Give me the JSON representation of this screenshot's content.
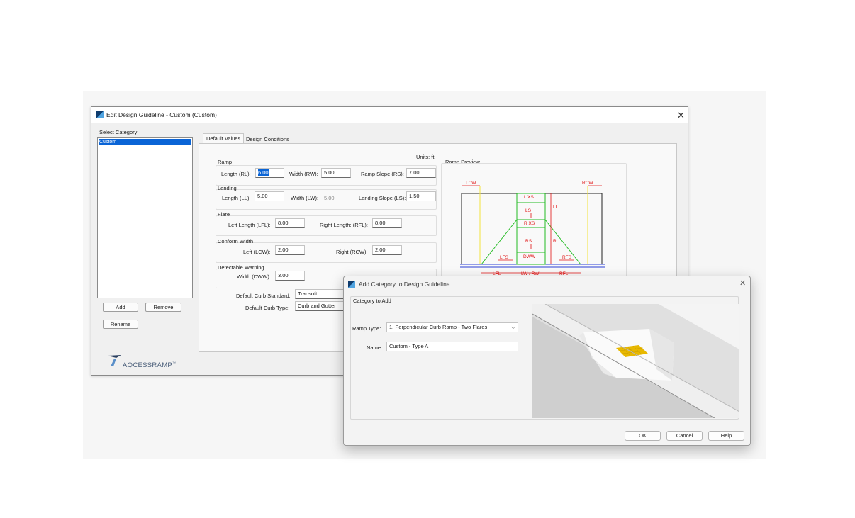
{
  "main_window": {
    "title": "Edit Design Guideline - Custom (Custom)",
    "close_glyph": "✕",
    "select_category_label": "Select Category:",
    "categories": [
      "Custom"
    ],
    "buttons": {
      "add": "Add",
      "remove": "Remove",
      "rename": "Rename"
    },
    "tabs": [
      "Default Values",
      "Design Conditions"
    ],
    "units_label": "Units: ft",
    "ramp": {
      "heading": "Ramp",
      "length_label": "Length (RL):",
      "length_value": "6.00",
      "width_label": "Width (RW):",
      "width_value": "5.00",
      "slope_label": "Ramp Slope (RS):",
      "slope_value": "7.00"
    },
    "landing": {
      "heading": "Landing",
      "length_label": "Length (LL):",
      "length_value": "5.00",
      "width_label": "Width (LW):",
      "width_value": "5.00",
      "slope_label": "Landing Slope (LS):",
      "slope_value": "1.50"
    },
    "flare": {
      "heading": "Flare",
      "left_label": "Left Length (LFL):",
      "left_value": "8.00",
      "right_label": "Right Length: (RFL):",
      "right_value": "8.00"
    },
    "conform": {
      "heading": "Conform Width",
      "left_label": "Left (LCW):",
      "left_value": "2.00",
      "right_label": "Right (RCW):",
      "right_value": "2.00"
    },
    "warning": {
      "heading": "Detectable Warning",
      "width_label": "Width (DWW):",
      "width_value": "3.00"
    },
    "curb_standard_label": "Default Curb Standard:",
    "curb_standard_value": "Transoft",
    "curb_type_label": "Default Curb Type:",
    "curb_type_value": "Curb and Gutter",
    "ramp_preview_label": "Ramp Preview",
    "diagram_labels": {
      "lcw": "LCW",
      "rcw": "RCW",
      "lxs": "L XS",
      "ls": "LS",
      "ll": "LL",
      "rxs": "R XS",
      "rs": "RS",
      "rl": "RL",
      "lfs": "LFS",
      "dww": "DWW",
      "rfs": "RFS",
      "lfl": "LFL",
      "lw_rw": "LW / RW",
      "rfl": "RFL"
    },
    "logo_text": "AQCESSRAMP",
    "logo_tm": "™"
  },
  "dialog": {
    "title": "Add Category to Design Guideline",
    "close_glyph": "✕",
    "section_label": "Category to Add",
    "ramp_type_label": "Ramp Type:",
    "ramp_type_value": "1. Perpendicular Curb Ramp - Two Flares",
    "name_label": "Name:",
    "name_value": "Custom - Type A",
    "buttons": {
      "ok": "OK",
      "cancel": "Cancel",
      "help": "Help"
    }
  },
  "colors": {
    "selection": "#0a64d6",
    "diagram_red": "#e01010",
    "diagram_green": "#22bb22",
    "diagram_yellow": "#f2e43a",
    "diagram_blue": "#2b3fd6",
    "warning_pad": "#e8b800"
  }
}
